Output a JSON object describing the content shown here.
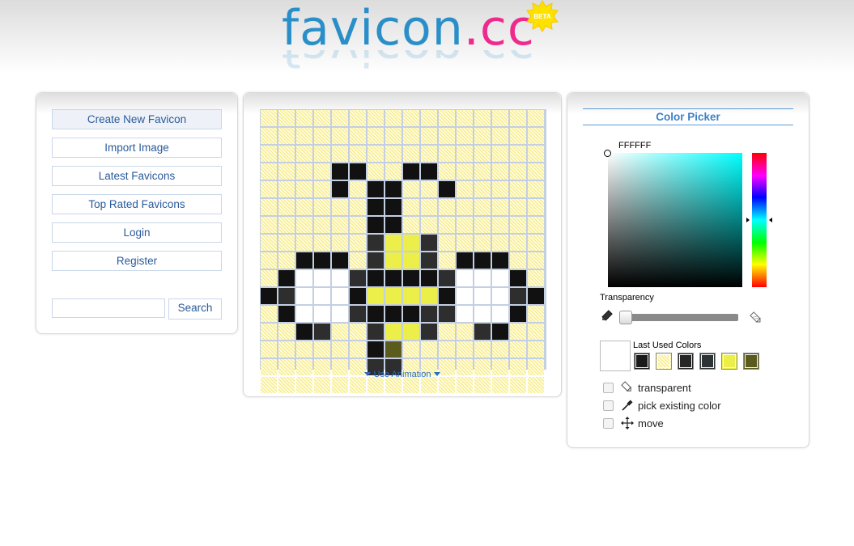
{
  "logo": {
    "favicon": "favicon",
    "dot": ".",
    "cc": "cc",
    "badge": "BETA"
  },
  "nav": {
    "items": [
      {
        "label": "Create New Favicon"
      },
      {
        "label": "Import Image"
      },
      {
        "label": "Latest Favicons"
      },
      {
        "label": "Top Rated Favicons"
      },
      {
        "label": "Login"
      },
      {
        "label": "Register"
      }
    ],
    "search_button": "Search",
    "search_value": ""
  },
  "editor": {
    "grid_size": 16,
    "animation_link": "Use Animation",
    "palette": {
      "K": "#111111",
      "D": "#2e2e2e",
      "W": "#ffffff",
      "Y": "#ecee49",
      "O": "#5b5b1e"
    },
    "pixels": [
      "................",
      "................",
      "................",
      "....KK..KK......",
      "....K.KK..K.....",
      "......KK........",
      "......KK........",
      "......DYYD......",
      "..KKK.DYYD.KKK..",
      ".KWWWDKKKKDWWWK.",
      "KDWWWKYYYYKWWWDK",
      ".KWWWDKKKDDWWWK.",
      "..KD..DYYD..DK..",
      "......KO........",
      "......DD........",
      "................"
    ]
  },
  "colorpicker": {
    "title": "Color Picker",
    "hex": "FFFFFF",
    "hue_color": "#00ffff",
    "transparency_label": "Transparency",
    "transparency_value": 0,
    "last_used_label": "Last Used Colors",
    "current_color": "#ffffff",
    "last_used": [
      "#1a1a1a",
      "transparent",
      "#262626",
      "#2e3436",
      "#ecee49",
      "#5b5b1e"
    ],
    "options": [
      {
        "label": "transparent",
        "icon": "eraser-icon"
      },
      {
        "label": "pick existing color",
        "icon": "eyedropper-icon"
      },
      {
        "label": "move",
        "icon": "move-icon"
      }
    ]
  }
}
